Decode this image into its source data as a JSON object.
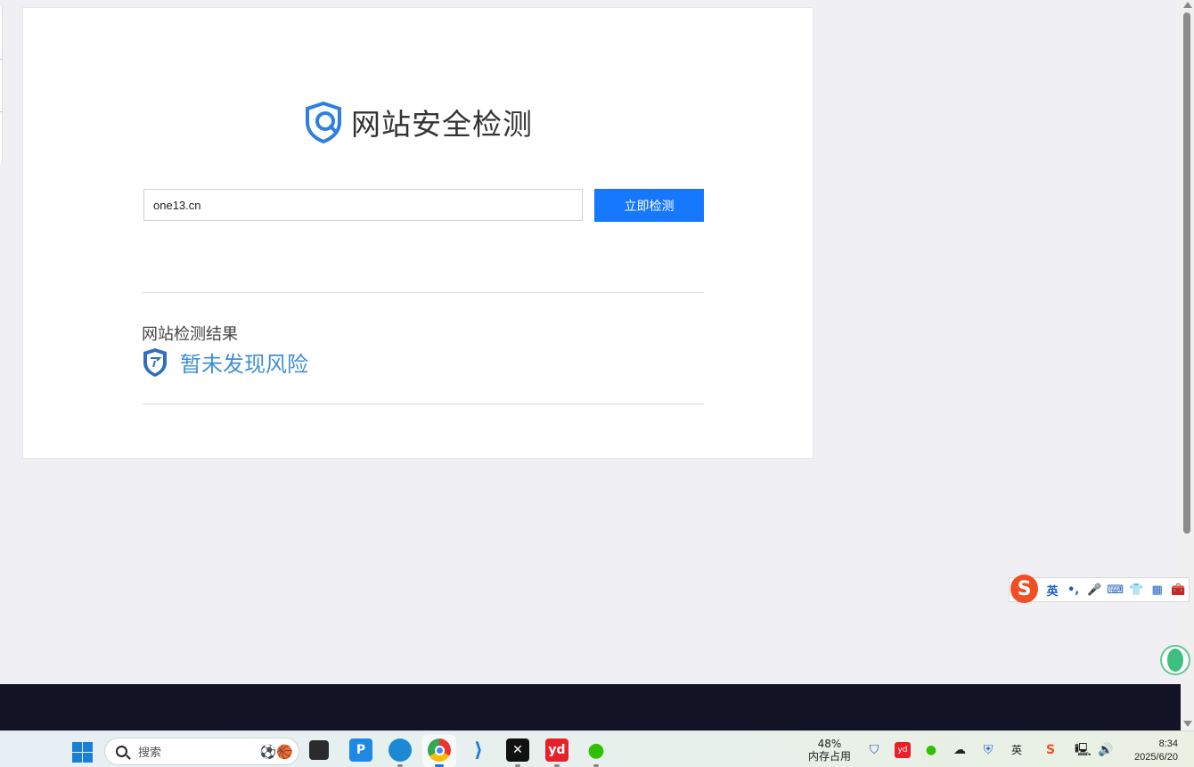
{
  "page": {
    "title": "网站安全检测",
    "search": {
      "value": "one13.cn",
      "placeholder": ""
    },
    "submit_label": "立即检测",
    "result_label": "网站检测结果",
    "result_status": "暂未发现风险"
  },
  "colors": {
    "accent": "#1677ff",
    "result_text": "#3f8fd6",
    "shield": "#2f7fe0"
  },
  "ime": {
    "logo": "S",
    "mode": "英",
    "punct": "•,",
    "icons": [
      "microphone-icon",
      "keyboard-icon",
      "skin-icon",
      "grid-icon",
      "toolbox-icon"
    ]
  },
  "taskbar": {
    "search_placeholder": "搜索",
    "apps": [
      "file-manager",
      "p-app",
      "edge",
      "chrome",
      "vscode",
      "capcut",
      "youdao",
      "wechat"
    ],
    "youdao_label": "yd",
    "p_label": "P",
    "memory_percent": "48%",
    "memory_label": "内存占用",
    "ime_tray": "英",
    "time": "8:34",
    "date": "2025/6/20"
  }
}
